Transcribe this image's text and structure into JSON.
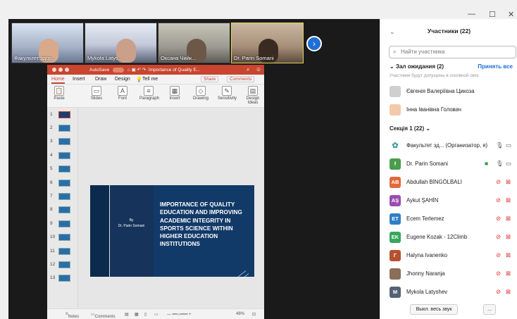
{
  "window": {
    "minimize": "—",
    "maximize": "☐",
    "close": "✕"
  },
  "gallery": {
    "tiles": [
      {
        "name": "Факультет здор...",
        "color": "#7c8aa7"
      },
      {
        "name": "Mykola Latys...",
        "color": "#b7b9c9"
      },
      {
        "name": "Оксана Чийк...",
        "color": "#8a8a84"
      },
      {
        "name": "Dr. Parin Somani",
        "color": "#8f7b68"
      }
    ],
    "next": "›"
  },
  "ppt": {
    "autosave": "AutoSave",
    "title": "Importance of Quality E...",
    "tabs": {
      "home": "Home",
      "insert": "Insert",
      "draw": "Draw",
      "design": "Design",
      "tellme": "Tell me",
      "share": "Share",
      "comments": "Comments"
    },
    "ribbon": [
      {
        "label": "Paste",
        "glyph": "📋"
      },
      {
        "label": "Slides",
        "glyph": "▭"
      },
      {
        "label": "Font",
        "glyph": "A"
      },
      {
        "label": "Paragraph",
        "glyph": "≡"
      },
      {
        "label": "Insert",
        "glyph": "▦"
      },
      {
        "label": "Drawing",
        "glyph": "◇"
      },
      {
        "label": "Sensitivity",
        "glyph": "✎"
      },
      {
        "label": "Design Ideas",
        "glyph": "▤"
      }
    ],
    "thumbs": [
      "1",
      "2",
      "3",
      "4",
      "5",
      "6",
      "7",
      "8",
      "9",
      "10",
      "11",
      "12",
      "13"
    ],
    "slide": {
      "by": "By",
      "author": "Dr. Parin Somani",
      "title": "IMPORTANCE OF QUALITY EDUCATION AND IMPROVING ACADEMIC INTEGRITY IN SPORTS SCIENCE WITHIN HIGHER EDUCATION INSTITUTIONS"
    },
    "status": {
      "notes": "Notes",
      "comments": "Comments",
      "zoom": "48%"
    }
  },
  "participants": {
    "title": "Участники (22)",
    "search_placeholder": "Найти участника",
    "waiting": "Зал ожидания (2)",
    "accept_all": "Принять все",
    "note": "Участники будут допущены в основной связ",
    "waiting_list": [
      {
        "name": "Євгенія Валеріївна Цикоза",
        "color": "#cfcfcf",
        "initials": ""
      },
      {
        "name": "Інна Іванівна Головач",
        "color": "#f2c9a9",
        "initials": ""
      }
    ],
    "section": "Секція 1 (22)",
    "list": [
      {
        "name": "Факультет зд... (Организатор, я)",
        "initials": "",
        "color": "#3aa0a8",
        "mic": "🎤",
        "cam": "▭",
        "muted": false
      },
      {
        "name": "Dr. Parin Somani",
        "initials": "f",
        "color": "#4a9c4e",
        "mic": "🎤",
        "cam": "▭",
        "muted": false
      },
      {
        "name": "Abdullah BİNGÖLBALI",
        "initials": "AB",
        "color": "#e2693a",
        "mic": "🎤",
        "cam": "▭",
        "muted": true
      },
      {
        "name": "Aykut ŞAHİN",
        "initials": "AŞ",
        "color": "#9b4db0",
        "mic": "🎤",
        "cam": "▭",
        "muted": true
      },
      {
        "name": "Ecem Terlemez",
        "initials": "ET",
        "color": "#2f7fc4",
        "mic": "🎤",
        "cam": "▭",
        "muted": true
      },
      {
        "name": "Eugene Kozak - 12Climb",
        "initials": "EK",
        "color": "#37a65e",
        "mic": "🎤",
        "cam": "▭",
        "muted": true
      },
      {
        "name": "Halyna Ivanenko",
        "initials": "Г",
        "color": "#b5522f",
        "mic": "🎤",
        "cam": "▭",
        "muted": true
      },
      {
        "name": "Jhonny Naranja",
        "initials": "",
        "color": "#8a6e58",
        "mic": "🎤",
        "cam": "▭",
        "muted": true
      },
      {
        "name": "Mykola Latyshev",
        "initials": "M",
        "color": "#546273",
        "mic": "🎤",
        "cam": "▭",
        "muted": true
      }
    ],
    "mute_all": "Выкл. весь звук",
    "more": "..."
  }
}
